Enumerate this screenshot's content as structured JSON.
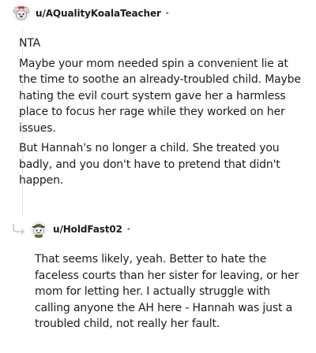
{
  "comments": [
    {
      "avatar_icon": "koala-avatar-icon",
      "username": "u/AQualityKoalaTeacher",
      "separator": "•",
      "paragraphs": [
        "NTA",
        "Maybe your mom needed spin a convenient lie at the time to soothe an already-troubled child. Maybe hating the evil court system gave her a harmless place to focus her rage while they worked on her issues.",
        "But Hannah's no longer a child. She treated you badly, and you don't have to pretend that didn't happen."
      ]
    },
    {
      "avatar_icon": "snoo-avatar-icon",
      "username": "u/HoldFast02",
      "separator": "•",
      "paragraphs": [
        "That seems likely, yeah. Better to hate the faceless courts than her sister for leaving, or her mom for letting her. I actually struggle with calling anyone the AH here - Hannah was just a troubled child, not really her fault."
      ]
    }
  ],
  "colors": {
    "text": "#1c1c1c",
    "meta": "#7c7c7c",
    "thread_line": "#e3e6e8",
    "reply_arrow": "#c2c7cc"
  }
}
